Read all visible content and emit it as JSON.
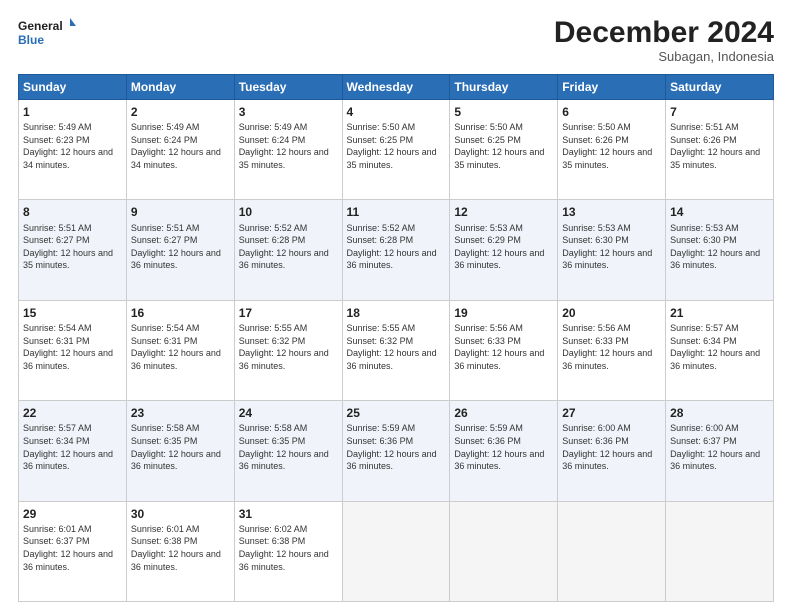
{
  "logo": {
    "line1": "General",
    "line2": "Blue"
  },
  "title": "December 2024",
  "subtitle": "Subagan, Indonesia",
  "days_header": [
    "Sunday",
    "Monday",
    "Tuesday",
    "Wednesday",
    "Thursday",
    "Friday",
    "Saturday"
  ],
  "weeks": [
    [
      {
        "day": 1,
        "sunrise": "5:49 AM",
        "sunset": "6:23 PM",
        "daylight": "12 hours and 34 minutes."
      },
      {
        "day": 2,
        "sunrise": "5:49 AM",
        "sunset": "6:24 PM",
        "daylight": "12 hours and 34 minutes."
      },
      {
        "day": 3,
        "sunrise": "5:49 AM",
        "sunset": "6:24 PM",
        "daylight": "12 hours and 35 minutes."
      },
      {
        "day": 4,
        "sunrise": "5:50 AM",
        "sunset": "6:25 PM",
        "daylight": "12 hours and 35 minutes."
      },
      {
        "day": 5,
        "sunrise": "5:50 AM",
        "sunset": "6:25 PM",
        "daylight": "12 hours and 35 minutes."
      },
      {
        "day": 6,
        "sunrise": "5:50 AM",
        "sunset": "6:26 PM",
        "daylight": "12 hours and 35 minutes."
      },
      {
        "day": 7,
        "sunrise": "5:51 AM",
        "sunset": "6:26 PM",
        "daylight": "12 hours and 35 minutes."
      }
    ],
    [
      {
        "day": 8,
        "sunrise": "5:51 AM",
        "sunset": "6:27 PM",
        "daylight": "12 hours and 35 minutes."
      },
      {
        "day": 9,
        "sunrise": "5:51 AM",
        "sunset": "6:27 PM",
        "daylight": "12 hours and 36 minutes."
      },
      {
        "day": 10,
        "sunrise": "5:52 AM",
        "sunset": "6:28 PM",
        "daylight": "12 hours and 36 minutes."
      },
      {
        "day": 11,
        "sunrise": "5:52 AM",
        "sunset": "6:28 PM",
        "daylight": "12 hours and 36 minutes."
      },
      {
        "day": 12,
        "sunrise": "5:53 AM",
        "sunset": "6:29 PM",
        "daylight": "12 hours and 36 minutes."
      },
      {
        "day": 13,
        "sunrise": "5:53 AM",
        "sunset": "6:30 PM",
        "daylight": "12 hours and 36 minutes."
      },
      {
        "day": 14,
        "sunrise": "5:53 AM",
        "sunset": "6:30 PM",
        "daylight": "12 hours and 36 minutes."
      }
    ],
    [
      {
        "day": 15,
        "sunrise": "5:54 AM",
        "sunset": "6:31 PM",
        "daylight": "12 hours and 36 minutes."
      },
      {
        "day": 16,
        "sunrise": "5:54 AM",
        "sunset": "6:31 PM",
        "daylight": "12 hours and 36 minutes."
      },
      {
        "day": 17,
        "sunrise": "5:55 AM",
        "sunset": "6:32 PM",
        "daylight": "12 hours and 36 minutes."
      },
      {
        "day": 18,
        "sunrise": "5:55 AM",
        "sunset": "6:32 PM",
        "daylight": "12 hours and 36 minutes."
      },
      {
        "day": 19,
        "sunrise": "5:56 AM",
        "sunset": "6:33 PM",
        "daylight": "12 hours and 36 minutes."
      },
      {
        "day": 20,
        "sunrise": "5:56 AM",
        "sunset": "6:33 PM",
        "daylight": "12 hours and 36 minutes."
      },
      {
        "day": 21,
        "sunrise": "5:57 AM",
        "sunset": "6:34 PM",
        "daylight": "12 hours and 36 minutes."
      }
    ],
    [
      {
        "day": 22,
        "sunrise": "5:57 AM",
        "sunset": "6:34 PM",
        "daylight": "12 hours and 36 minutes."
      },
      {
        "day": 23,
        "sunrise": "5:58 AM",
        "sunset": "6:35 PM",
        "daylight": "12 hours and 36 minutes."
      },
      {
        "day": 24,
        "sunrise": "5:58 AM",
        "sunset": "6:35 PM",
        "daylight": "12 hours and 36 minutes."
      },
      {
        "day": 25,
        "sunrise": "5:59 AM",
        "sunset": "6:36 PM",
        "daylight": "12 hours and 36 minutes."
      },
      {
        "day": 26,
        "sunrise": "5:59 AM",
        "sunset": "6:36 PM",
        "daylight": "12 hours and 36 minutes."
      },
      {
        "day": 27,
        "sunrise": "6:00 AM",
        "sunset": "6:36 PM",
        "daylight": "12 hours and 36 minutes."
      },
      {
        "day": 28,
        "sunrise": "6:00 AM",
        "sunset": "6:37 PM",
        "daylight": "12 hours and 36 minutes."
      }
    ],
    [
      {
        "day": 29,
        "sunrise": "6:01 AM",
        "sunset": "6:37 PM",
        "daylight": "12 hours and 36 minutes."
      },
      {
        "day": 30,
        "sunrise": "6:01 AM",
        "sunset": "6:38 PM",
        "daylight": "12 hours and 36 minutes."
      },
      {
        "day": 31,
        "sunrise": "6:02 AM",
        "sunset": "6:38 PM",
        "daylight": "12 hours and 36 minutes."
      },
      null,
      null,
      null,
      null
    ]
  ]
}
